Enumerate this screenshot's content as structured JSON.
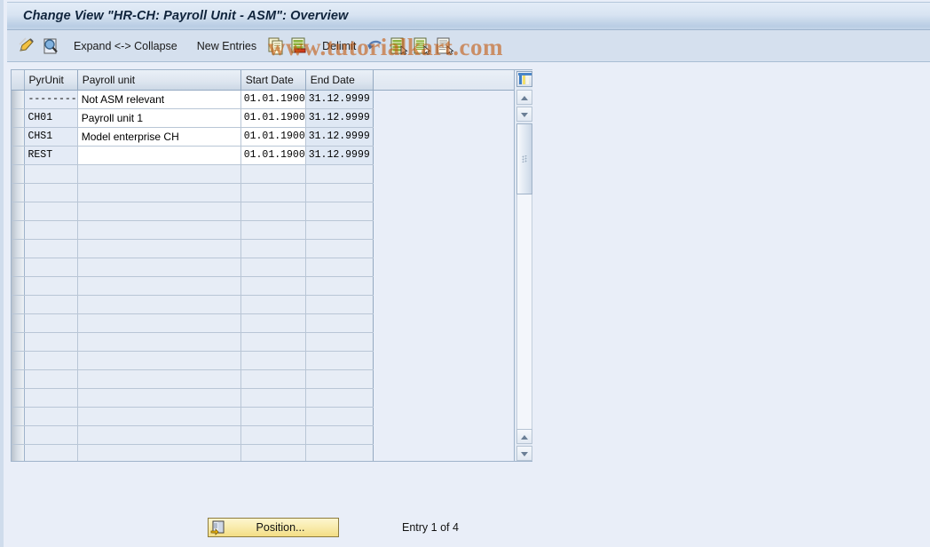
{
  "window": {
    "title": "Change View \"HR-CH: Payroll Unit - ASM\": Overview"
  },
  "watermark": {
    "text": "www.tutorialkart.com",
    "color": "#c45c12"
  },
  "toolbar": {
    "items": [
      {
        "name": "display-change-icon",
        "label": "",
        "type": "icon"
      },
      {
        "name": "details-icon",
        "label": "",
        "type": "icon"
      },
      {
        "name": "expand-collapse-button",
        "label": "Expand <-> Collapse",
        "type": "text"
      },
      {
        "name": "new-entries-button",
        "label": "New Entries",
        "type": "text"
      },
      {
        "name": "copy-as-icon",
        "label": "",
        "type": "icon"
      },
      {
        "name": "delete-icon",
        "label": "",
        "type": "icon"
      },
      {
        "name": "delimit-button",
        "label": "Delimit",
        "type": "text"
      },
      {
        "name": "undo-icon",
        "label": "",
        "type": "icon"
      },
      {
        "name": "select-all-icon",
        "label": "",
        "type": "icon"
      },
      {
        "name": "deselect-all-icon",
        "label": "",
        "type": "icon"
      },
      {
        "name": "print-preview-icon",
        "label": "",
        "type": "icon"
      }
    ]
  },
  "table": {
    "columns": [
      {
        "key": "pyrunit",
        "label": "PyrUnit"
      },
      {
        "key": "payroll_unit",
        "label": "Payroll unit"
      },
      {
        "key": "start_date",
        "label": "Start Date"
      },
      {
        "key": "end_date",
        "label": "End Date"
      }
    ],
    "rows": [
      {
        "pyrunit": "--------",
        "payroll_unit": "Not ASM relevant",
        "start_date": "01.01.1900",
        "end_date": "31.12.9999"
      },
      {
        "pyrunit": "CH01",
        "payroll_unit": "Payroll unit 1",
        "start_date": "01.01.1900",
        "end_date": "31.12.9999"
      },
      {
        "pyrunit": "CHS1",
        "payroll_unit": "Model enterprise CH",
        "start_date": "01.01.1900",
        "end_date": "31.12.9999"
      },
      {
        "pyrunit": "REST",
        "payroll_unit": "",
        "start_date": "01.01.1900",
        "end_date": "31.12.9999"
      }
    ],
    "empty_row_count": 16,
    "config_icon": "table-settings-icon"
  },
  "footer": {
    "position_button_label": "Position...",
    "position_button_icon": "position-icon",
    "entry_status": "Entry 1 of 4"
  },
  "colors": {
    "page_background": "#e9eef8",
    "titlebar_top": "#e3ecf7",
    "titlebar_bottom": "#b9cde4",
    "toolbar": "#d5e0ee",
    "grid_line": "#b9c6d6",
    "button_yellow": "#f8eaa8"
  }
}
